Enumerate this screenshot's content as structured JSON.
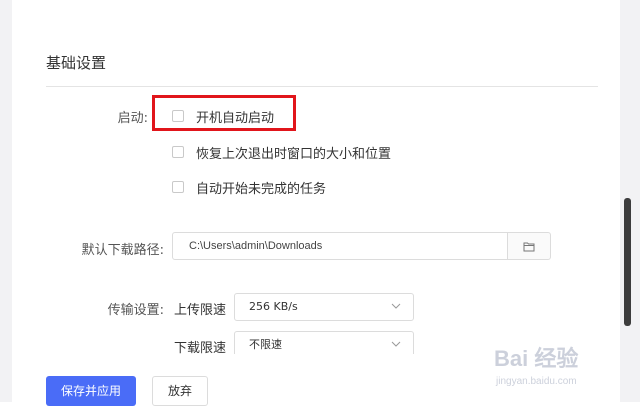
{
  "basic_settings": {
    "section_title": "基础设置",
    "startup_label": "启动:",
    "options": [
      {
        "label": "开机自动启动",
        "checked": false
      },
      {
        "label": "恢复上次退出时窗口的大小和位置",
        "checked": false
      },
      {
        "label": "自动开始未完成的任务",
        "checked": false
      }
    ],
    "download_path_label": "默认下载路径:",
    "download_path_value": "C:\\Users\\admin\\Downloads",
    "transfer_label": "传输设置:",
    "upload_limit_label": "上传限速",
    "upload_limit_value": "256 KB/s",
    "download_limit_label": "下载限速",
    "download_limit_value": "不限速"
  },
  "actions": {
    "save_apply": "保存并应用",
    "discard": "放弃"
  },
  "watermark": {
    "brand": "Bai 经验",
    "url": "jingyan.baidu.com"
  },
  "colors": {
    "primary": "#4a6cf7",
    "highlight": "#e1151b"
  },
  "icons": {
    "browse": "folder-icon",
    "dropdown": "chevron-down-icon"
  }
}
